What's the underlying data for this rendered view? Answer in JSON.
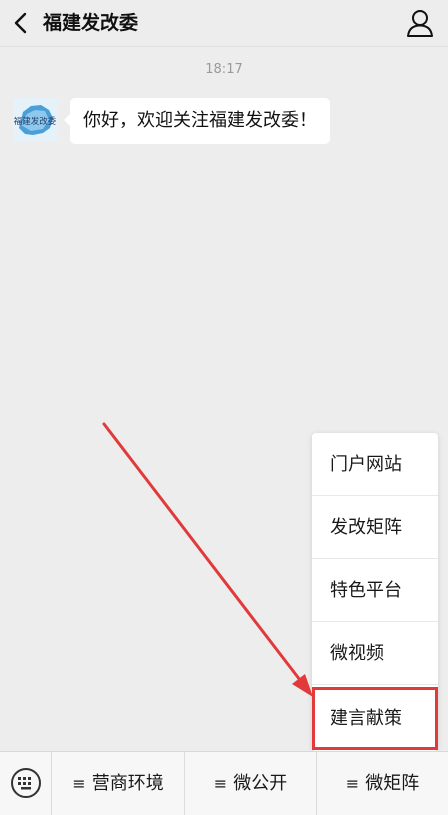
{
  "header": {
    "title": "福建发改委",
    "back_icon": "chevron-left-icon",
    "profile_icon": "person-icon"
  },
  "chat": {
    "timestamp": "18:17",
    "message": "你好，欢迎关注福建发改委！",
    "avatar_text": "福建发改委"
  },
  "menu": {
    "items": [
      {
        "label": "门户网站"
      },
      {
        "label": "发改矩阵"
      },
      {
        "label": "特色平台"
      },
      {
        "label": "微视频"
      },
      {
        "label": "建言献策"
      }
    ],
    "highlight_color": "#e03a3a"
  },
  "bottom_bar": {
    "keyboard_icon": "keyboard-icon",
    "tabs": [
      {
        "label": "营商环境",
        "icon": "≡"
      },
      {
        "label": "微公开",
        "icon": "≡"
      },
      {
        "label": "微矩阵",
        "icon": "≡"
      }
    ]
  },
  "colors": {
    "background": "#ededed",
    "annotation": "#e03a3a"
  }
}
